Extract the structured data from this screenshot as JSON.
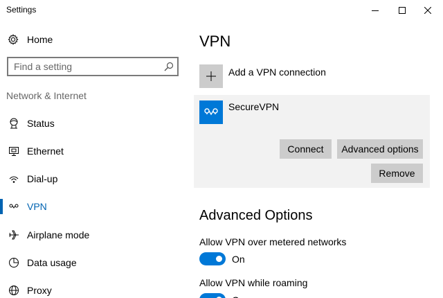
{
  "window": {
    "title": "Settings"
  },
  "sidebar": {
    "home_label": "Home",
    "search_placeholder": "Find a setting",
    "section_label": "Network & Internet",
    "items": [
      {
        "label": "Status",
        "icon": "status-icon",
        "active": false
      },
      {
        "label": "Ethernet",
        "icon": "ethernet-icon",
        "active": false
      },
      {
        "label": "Dial-up",
        "icon": "dialup-icon",
        "active": false
      },
      {
        "label": "VPN",
        "icon": "vpn-icon",
        "active": true
      },
      {
        "label": "Airplane mode",
        "icon": "airplane-icon",
        "active": false
      },
      {
        "label": "Data usage",
        "icon": "data-usage-icon",
        "active": false
      },
      {
        "label": "Proxy",
        "icon": "globe-icon",
        "active": false
      }
    ]
  },
  "main": {
    "title": "VPN",
    "add_connection_label": "Add a VPN connection",
    "connection": {
      "name": "SecureVPN",
      "connect_label": "Connect",
      "advanced_label": "Advanced options",
      "remove_label": "Remove"
    },
    "advanced_title": "Advanced Options",
    "options": [
      {
        "label": "Allow VPN over metered networks",
        "state": "On"
      },
      {
        "label": "Allow VPN while roaming",
        "state": "On"
      }
    ]
  },
  "colors": {
    "accent": "#0078d7",
    "active_nav": "#0063b1",
    "tile_gray": "#cccccc",
    "card_bg": "#f2f2f2"
  }
}
